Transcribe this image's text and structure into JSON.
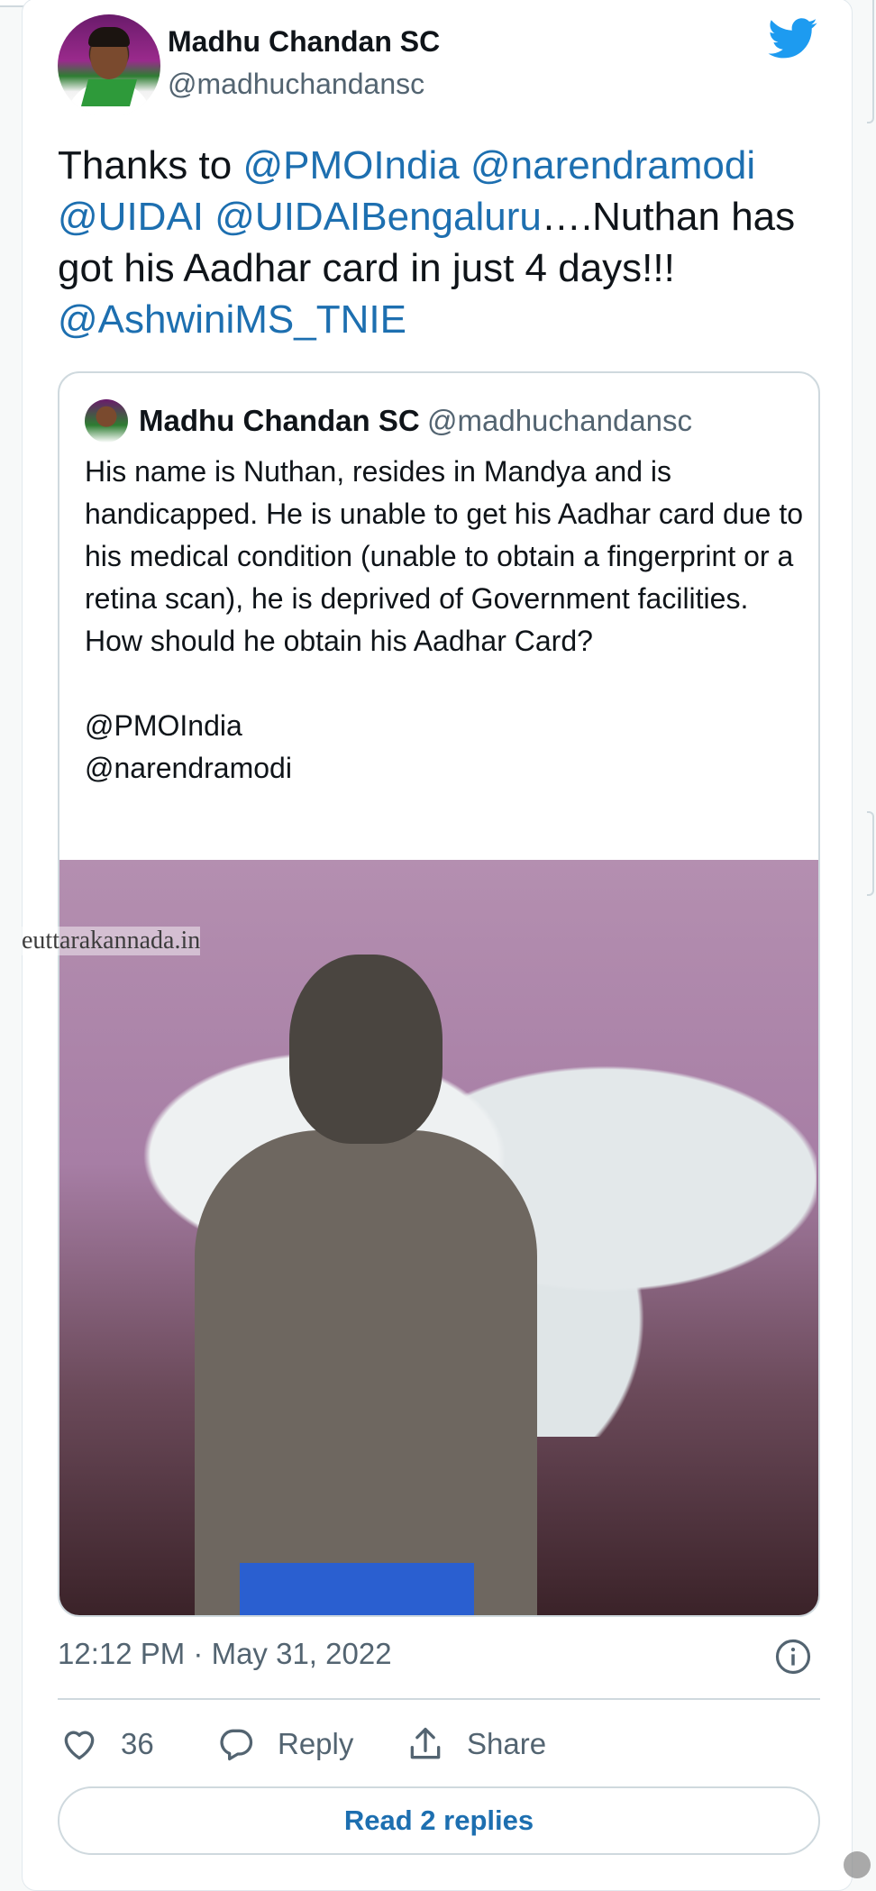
{
  "author": {
    "display_name": "Madhu Chandan SC",
    "handle": "@madhuchandansc"
  },
  "tweet": {
    "text_parts": [
      {
        "text": "Thanks to ",
        "mention": false
      },
      {
        "text": "@PMOIndia",
        "mention": true
      },
      {
        "text": " ",
        "mention": false
      },
      {
        "text": "@narendramodi",
        "mention": true
      },
      {
        "text": " ",
        "mention": false
      },
      {
        "text": "@UIDAI",
        "mention": true
      },
      {
        "text": " ",
        "mention": false
      },
      {
        "text": "@UIDAIBengaluru",
        "mention": true
      },
      {
        "text": "….Nuthan has got his Aadhar card in just 4 days!!! ",
        "mention": false
      },
      {
        "text": "@AshwiniMS_TNIE",
        "mention": true
      }
    ]
  },
  "quoted_tweet": {
    "display_name": "Madhu Chandan SC",
    "handle": "@madhuchandansc",
    "body": "His name is Nuthan, resides in Mandya and is handicapped. He is unable to get his Aadhar card due to his medical condition (unable to obtain a fingerprint or a retina scan), he is deprived of Government facilities. How should he obtain his Aadhar Card?",
    "mention_1": "@PMOIndia",
    "mention_2": "@narendramodi"
  },
  "watermark": "euttarakannada.in",
  "timestamp": "12:12 PM · May 31, 2022",
  "actions": {
    "like_count": "36",
    "reply_label": "Reply",
    "share_label": "Share"
  },
  "read_replies_label": "Read 2 replies",
  "colors": {
    "mention": "#1d6fb0",
    "twitter_blue": "#1d9bf0",
    "secondary_text": "#536471"
  },
  "icons": [
    "twitter-bird-icon",
    "info-icon",
    "heart-icon",
    "reply-bubble-icon",
    "share-icon"
  ]
}
